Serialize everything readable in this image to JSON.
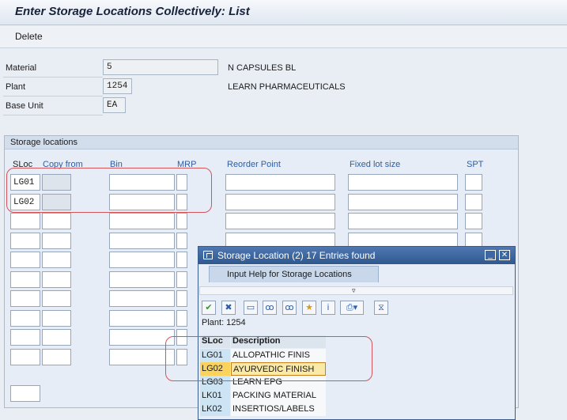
{
  "window": {
    "title": "Enter Storage Locations Collectively: List"
  },
  "toolbar": {
    "delete_label": "Delete"
  },
  "header": {
    "material_label": "Material",
    "material_value": "5",
    "material_text": "N CAPSULES BL",
    "plant_label": "Plant",
    "plant_value": "1254",
    "plant_text": "LEARN PHARMACEUTICALS",
    "base_unit_label": "Base Unit",
    "base_unit_value": "EA"
  },
  "storage": {
    "group_title": "Storage locations",
    "columns": [
      "SLoc",
      "Copy from",
      "Bin",
      "MRP",
      "Reorder Point",
      "Fixed lot size",
      "SPT"
    ],
    "rows": [
      {
        "sloc": "LG01"
      },
      {
        "sloc": "LG02"
      }
    ]
  },
  "popup": {
    "title": "Storage Location (2)   17 Entries found",
    "tab_label": "Input Help for Storage Locations",
    "plant_line": "Plant: 1254",
    "columns": [
      "SLoc",
      "Description"
    ],
    "results": [
      {
        "sloc": "LG01",
        "description": "ALLOPATHIC FINIS"
      },
      {
        "sloc": "LG02",
        "description": "AYURVEDIC FINISH",
        "selected": true
      },
      {
        "sloc": "LG03",
        "description": "LEARN EPG"
      },
      {
        "sloc": "LK01",
        "description": "PACKING MATERIAL"
      },
      {
        "sloc": "LK02",
        "description": "INSERTIOS/LABELS"
      }
    ],
    "toolbar_icons": [
      "check-icon",
      "close-icon",
      "document-icon",
      "binoculars-icon",
      "find-next-icon",
      "favorite-star-icon",
      "info-icon",
      "print-icon",
      "filter-icon"
    ]
  },
  "colors": {
    "title_bar": "#2f588f",
    "selected_row": "#fbd35c",
    "annotation": "#d2555a"
  }
}
